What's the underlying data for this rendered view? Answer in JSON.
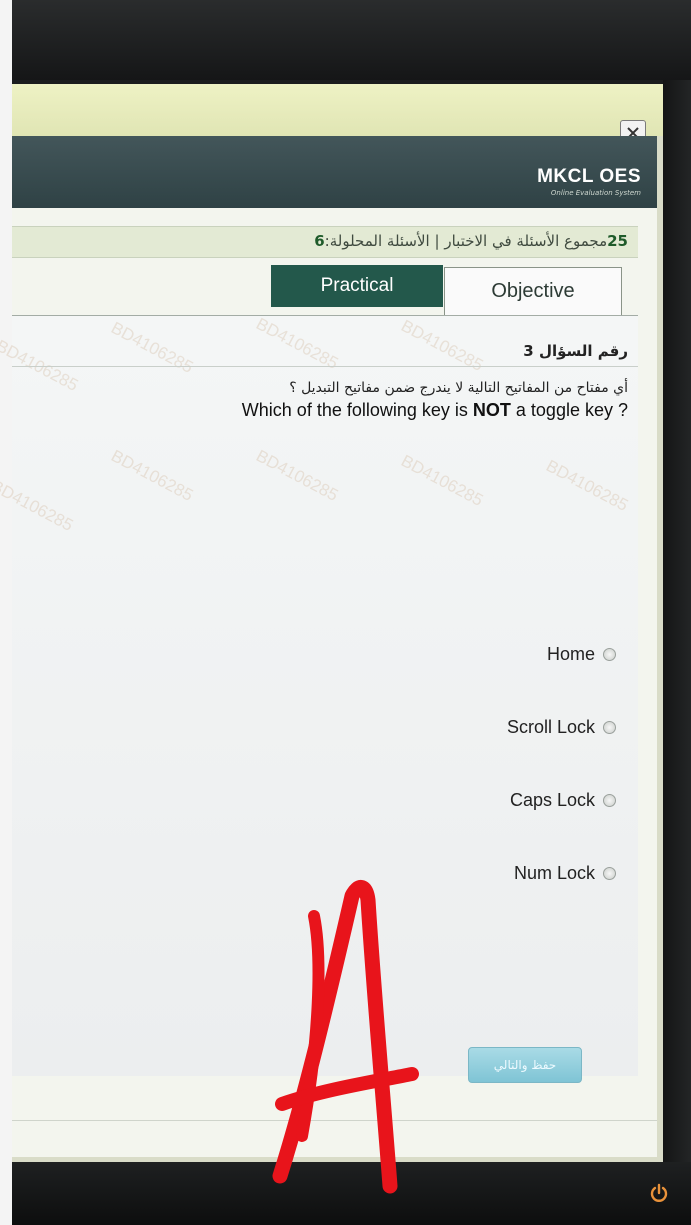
{
  "app": {
    "brand_name": "MKCL OES",
    "brand_sub": "Online Evaluation System"
  },
  "window": {
    "close_label": "X"
  },
  "stats": {
    "total_questions": "25",
    "total_label": "مجموع الأسئلة في الاختبار",
    "separator": "|",
    "solved_label": "الأسئلة المحلولة:",
    "solved_count": "6"
  },
  "tabs": {
    "practical": "Practical",
    "objective": "Objective"
  },
  "question": {
    "number_label": "رقم السؤال 3",
    "text_ar": "أي مفتاح من المفاتيح التالية لا يندرج ضمن مفاتيح التبديل ؟",
    "text_en_before": "Which of the following key is ",
    "text_en_bold": "NOT",
    "text_en_after": " a toggle key ?",
    "watermark": "BD4106285"
  },
  "options": [
    {
      "label": "Home"
    },
    {
      "label": "Scroll Lock"
    },
    {
      "label": "Caps Lock"
    },
    {
      "label": "Num Lock"
    }
  ],
  "actions": {
    "save_next": "حفظ والتالي"
  },
  "annotation": {
    "handwritten": "A",
    "color": "#e8141b"
  },
  "colors": {
    "tab_active": "#23584b",
    "header": "#3b4e52",
    "accent_green": "#1f5b2a"
  }
}
